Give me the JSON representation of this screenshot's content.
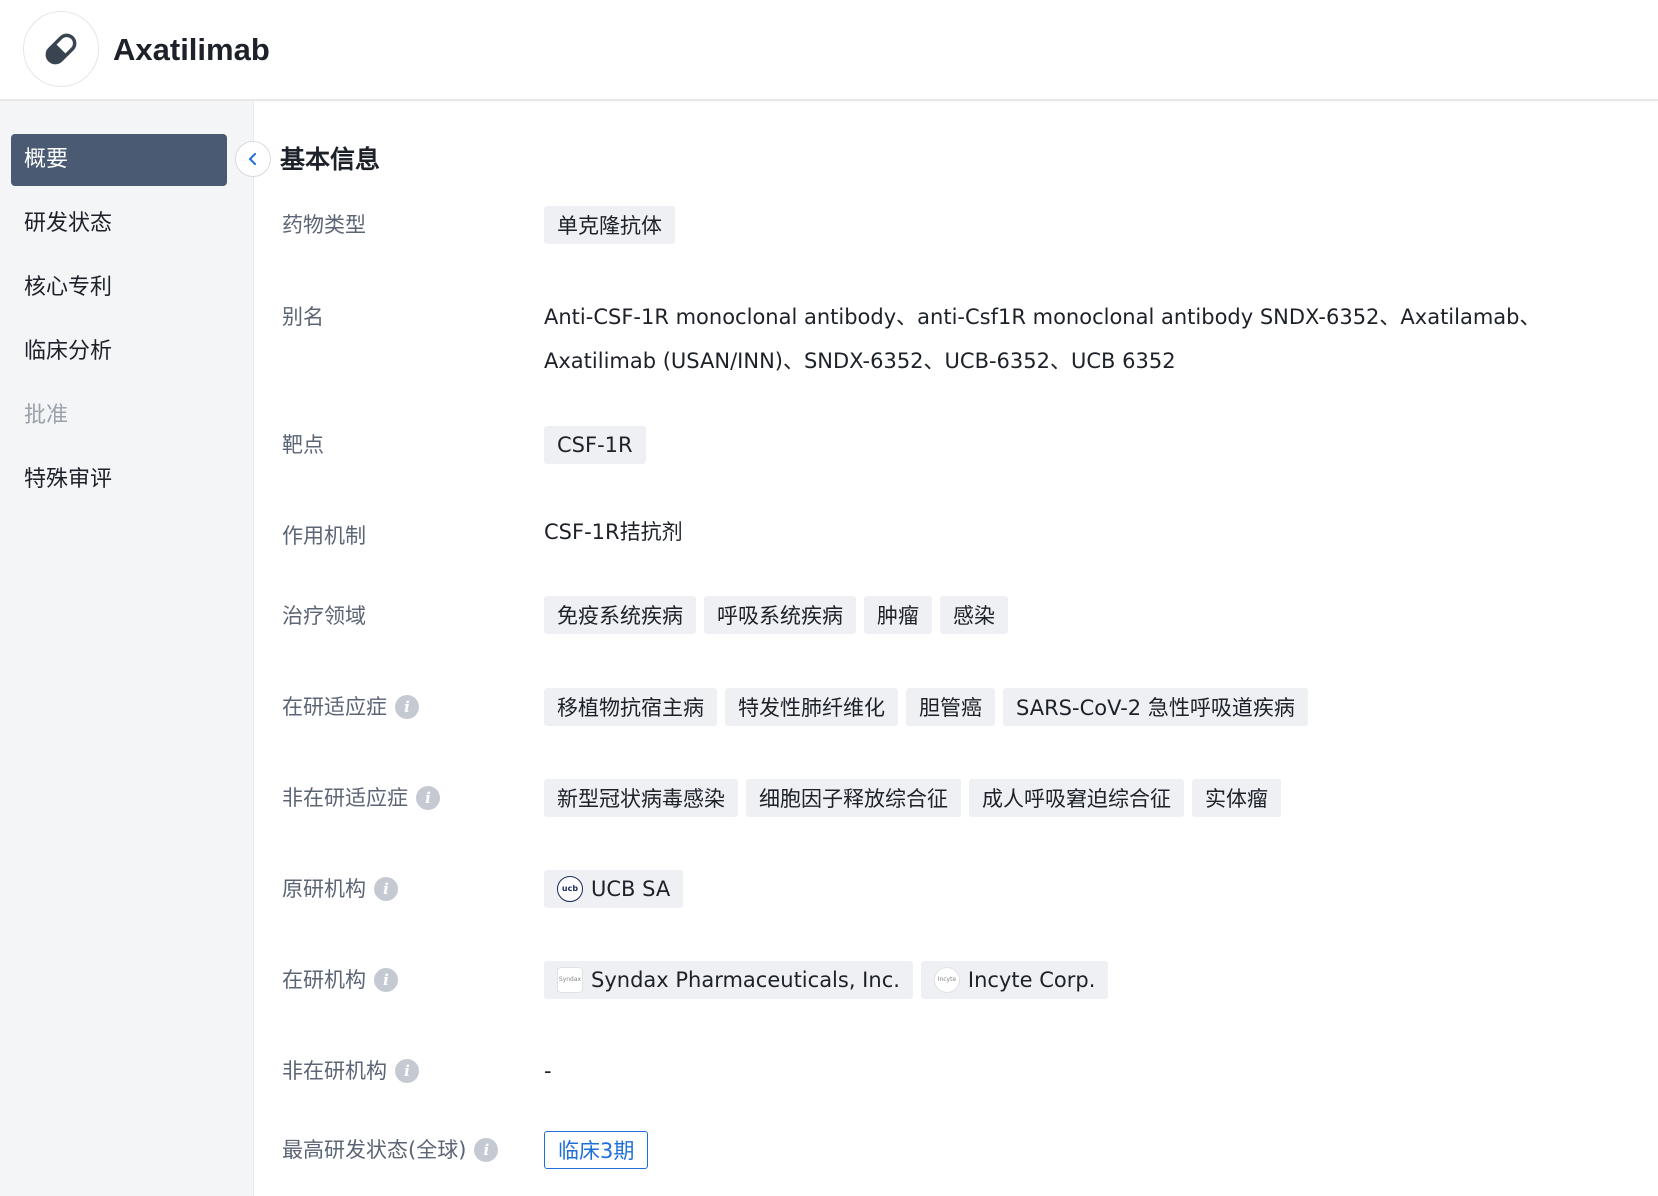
{
  "header": {
    "title": "Axatilimab",
    "logo_icon": "pill-icon"
  },
  "sidebar": {
    "items": [
      {
        "label": "概要",
        "state": "active"
      },
      {
        "label": "研发状态",
        "state": "normal"
      },
      {
        "label": "核心专利",
        "state": "normal"
      },
      {
        "label": "临床分析",
        "state": "normal"
      },
      {
        "label": "批准",
        "state": "disabled"
      },
      {
        "label": "特殊审评",
        "state": "normal"
      }
    ]
  },
  "section": {
    "title": "基本信息"
  },
  "fields": {
    "drug_type": {
      "label": "药物类型",
      "tags": [
        "单克隆抗体"
      ]
    },
    "alias": {
      "label": "别名",
      "line1": "Anti-CSF-1R monoclonal antibody、anti-Csf1R monoclonal antibody SNDX-6352、Axatilamab、",
      "line2": "Axatilimab (USAN/INN)、SNDX-6352、UCB-6352、UCB 6352"
    },
    "target": {
      "label": "靶点",
      "tags": [
        "CSF-1R"
      ]
    },
    "mechanism": {
      "label": "作用机制",
      "value": "CSF-1R拮抗剂"
    },
    "therapeutic_area": {
      "label": "治疗领域",
      "tags": [
        "免疫系统疾病",
        "呼吸系统疾病",
        "肿瘤",
        "感染"
      ]
    },
    "active_indications": {
      "label": "在研适应症",
      "tags": [
        "移植物抗宿主病",
        "特发性肺纤维化",
        "胆管癌",
        "SARS-CoV-2 急性呼吸道疾病"
      ]
    },
    "inactive_indications": {
      "label": "非在研适应症",
      "tags": [
        "新型冠状病毒感染",
        "细胞因子释放综合征",
        "成人呼吸窘迫综合征",
        "实体瘤"
      ]
    },
    "originator": {
      "label": "原研机构",
      "orgs": [
        {
          "name": "UCB SA",
          "logo_text": "ucb"
        }
      ]
    },
    "active_orgs": {
      "label": "在研机构",
      "orgs": [
        {
          "name": "Syndax Pharmaceuticals, Inc.",
          "logo_text": "Syndax"
        },
        {
          "name": "Incyte Corp.",
          "logo_text": "Incyte"
        }
      ]
    },
    "inactive_orgs": {
      "label": "非在研机构",
      "value": "-"
    },
    "highest_phase": {
      "label": "最高研发状态(全球)",
      "value": "临床3期"
    }
  },
  "colors": {
    "active_nav": "#4a5a72",
    "link_blue": "#1e6fd9",
    "tag_bg": "#eef0f3"
  }
}
